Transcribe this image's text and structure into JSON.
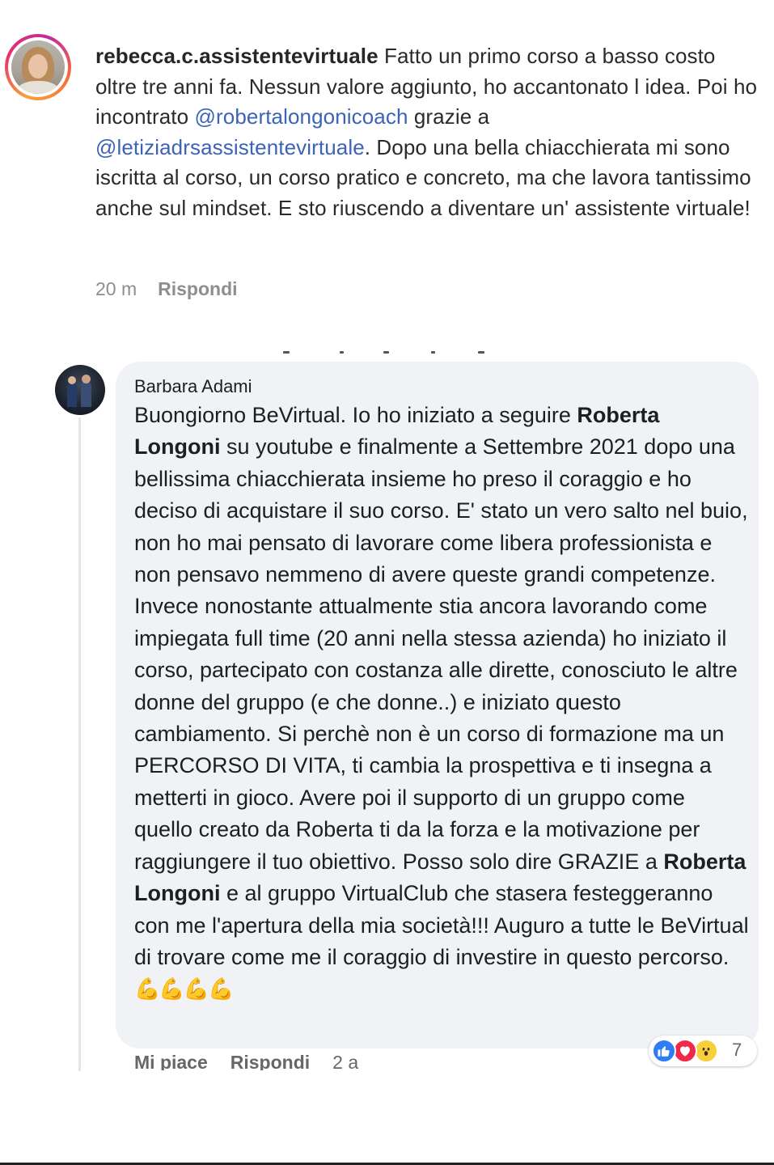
{
  "instagram_comment": {
    "username": "rebecca.c.assistentevirtuale",
    "text_1": " Fatto un primo corso a basso costo oltre tre anni fa. Nessun valore aggiunto, ho accantonato l idea. Poi ho incontrato ",
    "mention_1": "@robertalongonicoach",
    "text_2": " grazie a ",
    "mention_2": "@letiziadrsassistentevirtuale",
    "text_3": ". Dopo una bella chiacchierata mi sono iscritta al corso, un corso pratico e concreto, ma che lavora tantissimo anche sul mindset. E sto riuscendo a diventare un' assistente virtuale!",
    "time": "20 m",
    "reply_label": "Rispondi"
  },
  "facebook_comment": {
    "author": "Barbara Adami",
    "t1": "Buongiorno BeVirtual. Io ho iniziato a seguire ",
    "b1": "Roberta Longoni",
    "t2": " su youtube e finalmente a Settembre 2021 dopo una bellissima chiacchierata insieme ho preso il coraggio e ho deciso di acquistare il suo corso. E' stato un vero salto nel buio, non ho mai pensato di lavorare come libera professionista e non pensavo nemmeno di avere queste grandi competenze. Invece nonostante attualmente stia ancora lavorando come impiegata full time (20 anni nella stessa azienda) ho iniziato il corso, partecipato con costanza alle dirette, conosciuto le altre donne del gruppo (e che donne..) e iniziato questo cambiamento. Si perchè non è un corso di formazione ma un PERCORSO DI VITA, ti cambia la prospettiva e ti insegna a metterti in gioco. Avere poi il supporto di un gruppo come quello creato da Roberta ti da la forza e la motivazione per raggiungere il tuo obiettivo. Posso solo dire GRAZIE a ",
    "b2": "Roberta Longoni",
    "t3": " e al gruppo VirtualClub che stasera festeggeranno con me l'apertura della mia società!!! Auguro a tutte le BeVirtual di trovare come me il coraggio di investire in questo percorso. ",
    "emojis": "💪💪💪💪",
    "reactions": {
      "icons": [
        "like-icon",
        "love-icon",
        "wow-icon"
      ],
      "count": "7"
    },
    "actions": {
      "like_label": "Mi piace",
      "reply_label": "Rispondi",
      "time": "2 a"
    }
  },
  "colors": {
    "mention": "#3d63b8",
    "bubble": "#f0f2f5",
    "like": "#2f7df6",
    "love": "#f0284a",
    "wow": "#f7cf3b"
  }
}
